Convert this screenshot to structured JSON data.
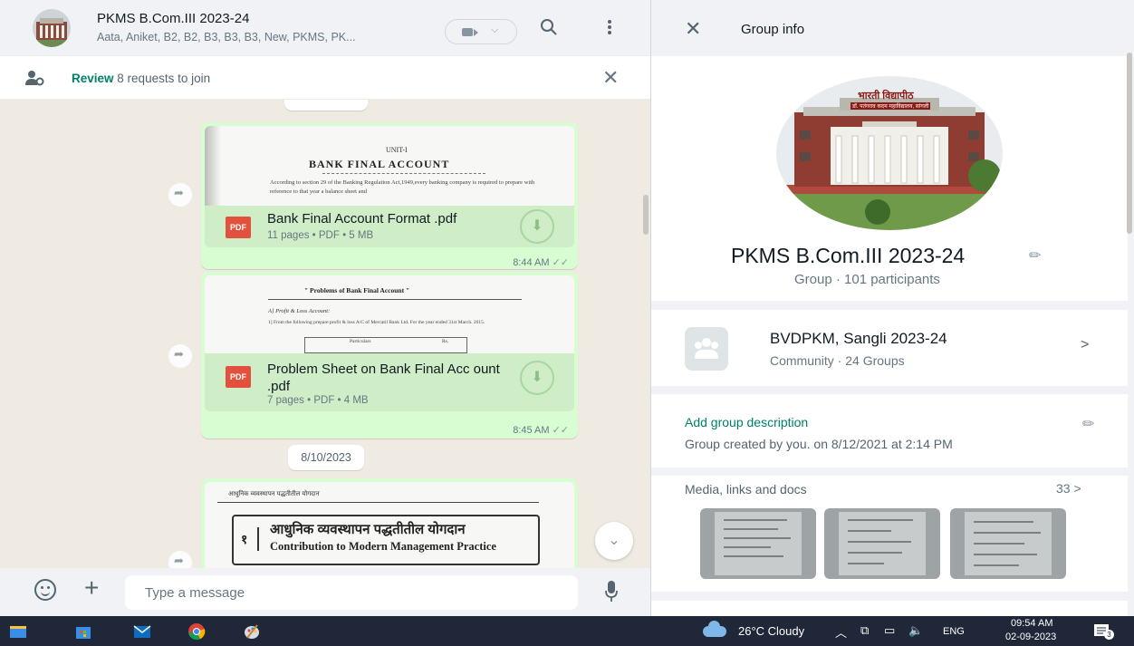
{
  "chat": {
    "title": "PKMS B.Com.III 2023-24",
    "participants_preview": "Aata, Aniket, B2, B2, B3, B3, B3, New, PKMS, PK...",
    "review_action": "Review",
    "review_text": "8 requests to join",
    "date_separator": "8/10/2023",
    "composer_placeholder": "Type a message",
    "messages": [
      {
        "preview_unit": "UNIT-I",
        "preview_heading": "BANK FINAL ACCOUNT",
        "preview_body": "According to section 29 of the Banking Regulation Act,1949,every banking company is required to prepare with reference to that year a balance sheet and",
        "file_name": "Bank Final Account Format .pdf",
        "file_meta": "11 pages • PDF • 5 MB",
        "file_type": "PDF",
        "time": "8:44 AM"
      },
      {
        "preview_heading": "\" Problems of Bank Final Account \"",
        "preview_sub": "A] Profit & Loss Account:",
        "preview_body": "1] From the following prepare profit & loss A/C of Mercatil Bank Ltd. For the year ended 31st March. 2015.",
        "preview_col1": "Particulars",
        "preview_col2": "Rs.",
        "file_name": "Problem Sheet on Bank Final Acc ount .pdf",
        "file_meta": "7 pages • PDF • 4 MB",
        "file_type": "PDF",
        "time": "8:45 AM"
      },
      {
        "preview_header": "आधुनिक व्यवस्थापन पद्धतीतील योगदान",
        "preview_chapter": "१",
        "preview_title_mr": "आधुनिक व्यवस्थापन पद्धतीतील योगदान",
        "preview_title_en": "Contribution to Modern Management Practice"
      }
    ]
  },
  "info": {
    "header_title": "Group info",
    "seal_text": "भारती विद्यापीठ",
    "seal_subtext": "डॉ. पतंगराव कदम महाविद्यालय, सांगली",
    "group_name": "PKMS B.Com.III 2023-24",
    "group_meta": "Group · 101 participants",
    "community_name": "BVDPKM, Sangli 2023-24",
    "community_meta": "Community · 24 Groups",
    "add_description": "Add group description",
    "created_text": "Group created by you. on 8/12/2021 at 2:14 PM",
    "media_label": "Media, links and docs",
    "media_count": "33"
  },
  "taskbar": {
    "weather": "26°C  Cloudy",
    "language": "ENG",
    "time": "09:54 AM",
    "date": "02-09-2023",
    "notifications": "3"
  },
  "colors": {
    "accent_green": "#008069",
    "bubble_green": "#d9fdd3",
    "chat_background": "#efeae2",
    "pdf_red": "#e2513d"
  },
  "icons": [
    "search-icon",
    "menu-icon",
    "video-call-icon",
    "close-icon",
    "pencil-icon",
    "download-icon",
    "forward-icon",
    "emoji-icon",
    "plus-icon",
    "mic-icon",
    "chevron-right-icon",
    "chevron-down-icon"
  ]
}
